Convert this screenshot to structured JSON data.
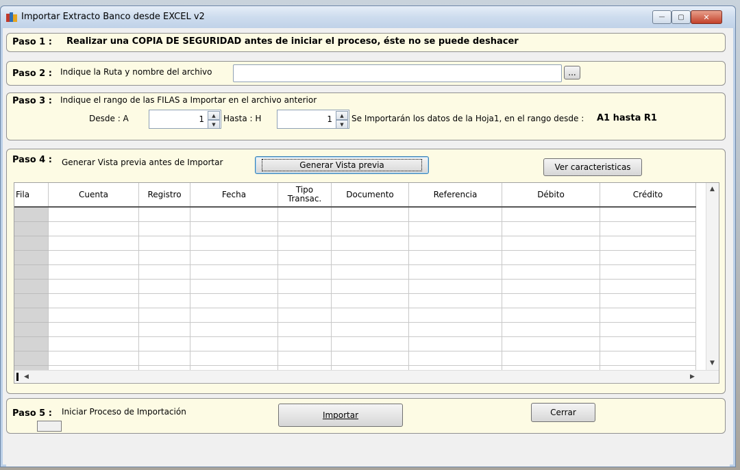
{
  "window": {
    "title": "Importar Extracto Banco desde EXCEL v2",
    "controls": {
      "minimize": "—",
      "maximize": "▢",
      "close": "✕"
    }
  },
  "step1": {
    "label": "Paso 1 :",
    "text": "Realizar una COPIA DE SEGURIDAD antes de iniciar el proceso, éste no se puede deshacer"
  },
  "step2": {
    "label": "Paso 2 :",
    "text": "Indique la Ruta y nombre del archivo",
    "path_value": "",
    "browse_label": "..."
  },
  "step3": {
    "label": "Paso 3 :",
    "text": "Indique el rango de las FILAS a Importar en el archivo anterior",
    "from_label": "Desde  :  A",
    "from_value": "1",
    "to_label": "Hasta  :  H",
    "to_value": "1",
    "summary": "Se Importarán los datos de la Hoja1,  en el rango desde :",
    "range": "A1 hasta R1"
  },
  "step4": {
    "label": "Paso 4 :",
    "text": "Generar Vista previa antes de Importar",
    "preview_button": "Generar Vista previa",
    "features_button": "Ver caracteristicas"
  },
  "grid": {
    "columns": [
      "Fila",
      "Cuenta",
      "Registro",
      "Fecha",
      "Tipo\nTransac.",
      "Documento",
      "Referencia",
      "Débito",
      "Crédito"
    ],
    "rows": 12
  },
  "step5": {
    "label": "Paso 5 :",
    "text": "Iniciar Proceso de Importación",
    "import_button": "Importar",
    "close_button": "Cerrar"
  }
}
